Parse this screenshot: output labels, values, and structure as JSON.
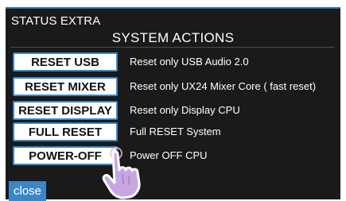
{
  "panel": {
    "title": "STATUS EXTRA"
  },
  "section": {
    "title": "SYSTEM ACTIONS"
  },
  "actions": [
    {
      "label": "RESET USB",
      "description": "Reset only USB Audio 2.0"
    },
    {
      "label": "RESET MIXER",
      "description": "Reset only UX24 Mixer Core ( fast reset)"
    },
    {
      "label": "RESET DISPLAY",
      "description": "Reset only Display CPU"
    },
    {
      "label": "FULL RESET",
      "description": "Full RESET System"
    },
    {
      "label": "POWER-OFF",
      "description": "Power OFF CPU"
    }
  ],
  "footer": {
    "close_label": "close"
  },
  "overlay": {
    "icon": "hand-pointer-icon"
  },
  "colors": {
    "panel_background": "#1a1a1a",
    "accent": "#3d86c6",
    "text": "#ffffff",
    "button_background": "#ffffff",
    "pointer_fill": "#c9a6e2",
    "pointer_outline": "#ffffff"
  }
}
